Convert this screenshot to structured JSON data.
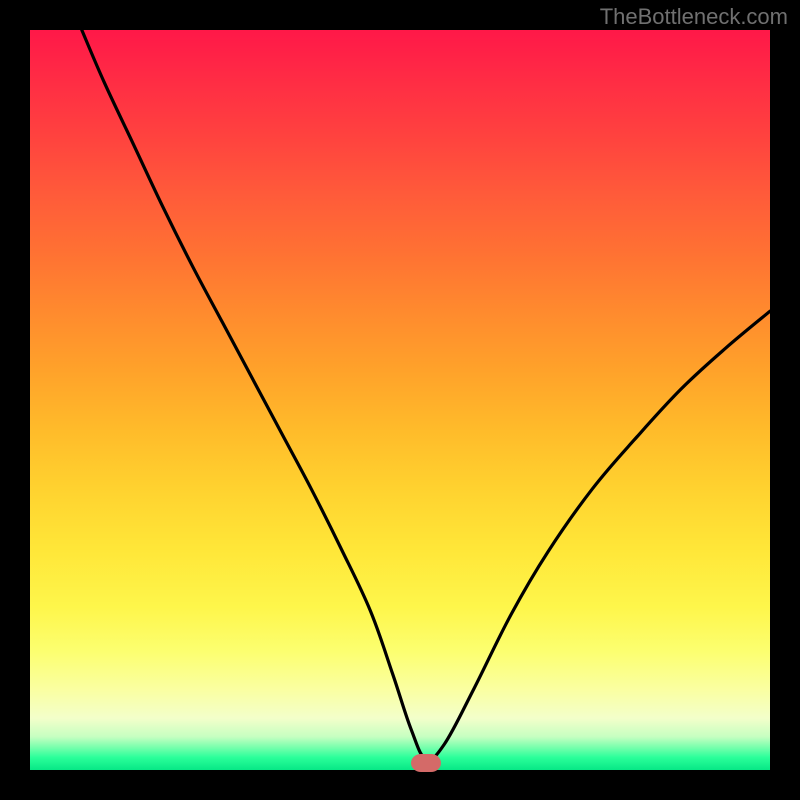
{
  "watermark": "TheBottleneck.com",
  "colors": {
    "background": "#000000",
    "watermark": "#707070",
    "curve": "#000000",
    "marker": "#d46a68",
    "gradient_stops": [
      {
        "pos": 0,
        "color": "#ff1848"
      },
      {
        "pos": 6,
        "color": "#ff2a45"
      },
      {
        "pos": 14,
        "color": "#ff413f"
      },
      {
        "pos": 22,
        "color": "#ff5a3a"
      },
      {
        "pos": 30,
        "color": "#ff7133"
      },
      {
        "pos": 38,
        "color": "#ff8a2e"
      },
      {
        "pos": 46,
        "color": "#ffa22a"
      },
      {
        "pos": 54,
        "color": "#ffbb2a"
      },
      {
        "pos": 62,
        "color": "#ffd22f"
      },
      {
        "pos": 70,
        "color": "#ffe638"
      },
      {
        "pos": 78,
        "color": "#fef64b"
      },
      {
        "pos": 84,
        "color": "#fcff70"
      },
      {
        "pos": 89,
        "color": "#faffa0"
      },
      {
        "pos": 93,
        "color": "#f3ffca"
      },
      {
        "pos": 95.5,
        "color": "#c6ffc1"
      },
      {
        "pos": 97,
        "color": "#74ffac"
      },
      {
        "pos": 98.3,
        "color": "#2bff9a"
      },
      {
        "pos": 100,
        "color": "#07e886"
      }
    ]
  },
  "chart_data": {
    "type": "line",
    "title": "",
    "xlabel": "",
    "ylabel": "",
    "xlim": [
      0,
      100
    ],
    "ylim": [
      0,
      100
    ],
    "note": "Bottleneck-style V curve. x and y are in percent of the plot area (0–100). y=100 is the top (red / high bottleneck), y≈0 is the green bottom. The minimum (optimal point) sits near x≈53.",
    "series": [
      {
        "name": "bottleneck_curve",
        "x": [
          7,
          10,
          14,
          18,
          22,
          26,
          30,
          34,
          38,
          42,
          46,
          49,
          51.5,
          53.5,
          56,
          60,
          65,
          70,
          76,
          82,
          88,
          94,
          100
        ],
        "y": [
          100,
          93,
          84.5,
          76,
          68,
          60.5,
          53,
          45.5,
          38,
          30,
          21.5,
          13,
          5.5,
          1.5,
          3.5,
          11,
          21,
          29.5,
          38,
          45,
          51.5,
          57,
          62
        ]
      }
    ],
    "marker": {
      "x": 53.5,
      "y": 1.0
    },
    "grid": false,
    "legend": false
  }
}
